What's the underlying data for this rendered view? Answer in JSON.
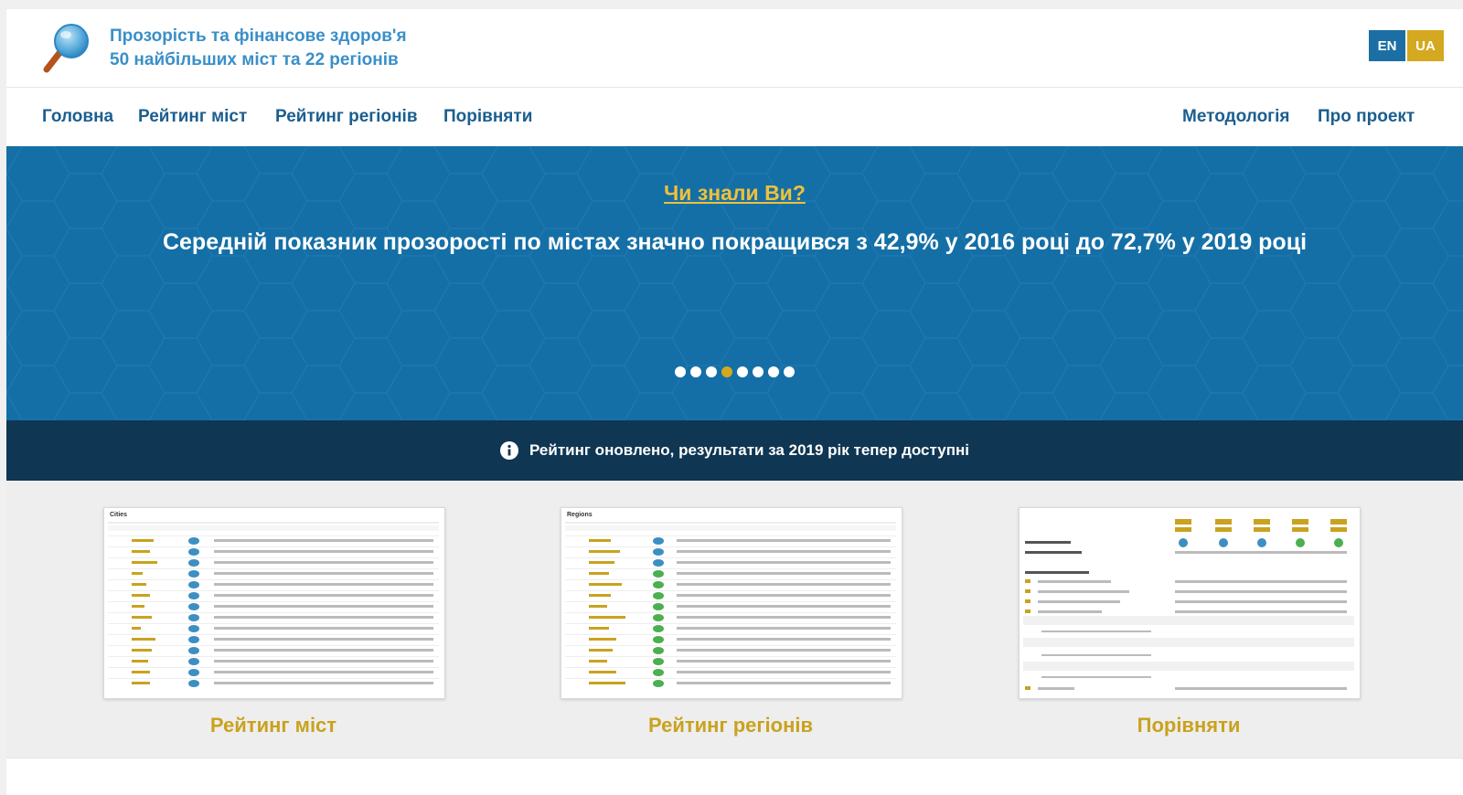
{
  "header": {
    "title_line1": "Прозорість та фінансове здоров'я",
    "title_line2": "50 найбільших міст та 22 регіонів",
    "logo_icon": "magnifier-icon",
    "lang_en": "EN",
    "lang_ua": "UA",
    "colors": {
      "title": "#3a8fc8",
      "en": "#1b6fa5",
      "ua": "#d4a81f"
    }
  },
  "nav": {
    "home": "Головна",
    "city_rating": "Рейтинг міст",
    "region_rating": "Рейтинг регіонів",
    "compare": "Порівняти",
    "methodology": "Методологія",
    "about": "Про проект"
  },
  "hero": {
    "title": "Чи знали Ви?",
    "text": "Середній показник прозорості по містах значно покращився з 42,9% у 2016 році до 72,7% у 2019 році",
    "slides": 8,
    "active_slide": 4,
    "colors": {
      "background": "#146fa6",
      "title": "#f0c03a",
      "active_dot": "#d4a81f"
    }
  },
  "notice": {
    "icon": "info-icon",
    "text": "Рейтинг оновлено, результати за 2019 рік тепер доступні"
  },
  "cards": [
    {
      "thumb_title": "Cities",
      "label": "Рейтинг міст"
    },
    {
      "thumb_title": "Regions",
      "label": "Рейтинг регіонів"
    },
    {
      "thumb_title": "",
      "label": "Порівняти"
    }
  ]
}
